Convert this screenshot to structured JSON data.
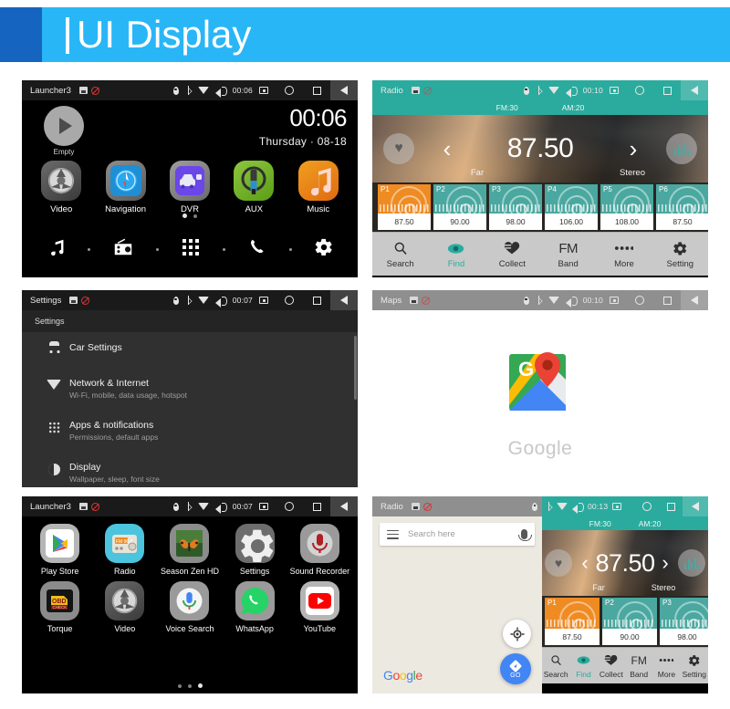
{
  "banner": {
    "title": "UI Display",
    "accent": "#29b6f6",
    "accent_dark": "#1565c0"
  },
  "panels": {
    "launcher": {
      "statusbar": {
        "title": "Launcher3",
        "clock": "00:06",
        "icons": [
          "sd-card-icon",
          "no-sim-icon",
          "location-icon",
          "bluetooth-icon",
          "wifi-icon",
          "volume-icon",
          "screenshot-icon",
          "home-icon",
          "recents-icon",
          "back-icon"
        ]
      },
      "clock": "00:06",
      "date": "Thursday · 08-18",
      "empty_slot_label": "Empty",
      "apps": [
        {
          "label": "Video",
          "icon": "video-reel-icon"
        },
        {
          "label": "Navigation",
          "icon": "compass-icon"
        },
        {
          "label": "DVR",
          "icon": "dashcam-icon"
        },
        {
          "label": "AUX",
          "icon": "aux-jack-icon"
        },
        {
          "label": "Music",
          "icon": "music-note-icon"
        }
      ],
      "page_dots": 2,
      "page_active": 0,
      "dock": [
        "music-note-icon",
        "radio-icon",
        "app-grid-icon",
        "phone-icon",
        "settings-gear-icon"
      ]
    },
    "radio": {
      "statusbar": {
        "title": "Radio",
        "clock": "00:10"
      },
      "band_info": {
        "fm": "FM:30",
        "am": "AM:20"
      },
      "frequency": "87.50",
      "mode_left": "Far",
      "mode_right": "Stereo",
      "prev_icon": "chevron-left-icon",
      "next_icon": "chevron-right-icon",
      "favorite_icon": "heart-icon",
      "equalizer_icon": "equalizer-icon",
      "presets": [
        {
          "slot": "P1",
          "freq": "87.50",
          "active": true
        },
        {
          "slot": "P2",
          "freq": "90.00",
          "active": false
        },
        {
          "slot": "P3",
          "freq": "98.00",
          "active": false
        },
        {
          "slot": "P4",
          "freq": "106.00",
          "active": false
        },
        {
          "slot": "P5",
          "freq": "108.00",
          "active": false
        },
        {
          "slot": "P6",
          "freq": "87.50",
          "active": false
        }
      ],
      "toolbar": [
        {
          "label": "Search",
          "icon": "magnifier-icon",
          "active": false
        },
        {
          "label": "Find",
          "icon": "eye-icon",
          "active": true
        },
        {
          "label": "Collect",
          "icon": "collect-icon",
          "active": false
        },
        {
          "label": "Band",
          "icon": "fm-text-icon",
          "active": false,
          "top_text": "FM"
        },
        {
          "label": "More",
          "icon": "more-dots-icon",
          "active": false
        },
        {
          "label": "Setting",
          "icon": "gear-icon",
          "active": false
        }
      ],
      "accent": "#2bab9e",
      "active_preset_color": "#ef8b23"
    },
    "settings": {
      "statusbar": {
        "title": "Settings",
        "clock": "00:07"
      },
      "header": "Settings",
      "items": [
        {
          "title": "Car Settings",
          "subtitle": "",
          "icon": "car-icon"
        },
        {
          "title": "Network & Internet",
          "subtitle": "Wi-Fi, mobile, data usage, hotspot",
          "icon": "wifi-icon"
        },
        {
          "title": "Apps & notifications",
          "subtitle": "Permissions, default apps",
          "icon": "apps-grid-icon"
        },
        {
          "title": "Display",
          "subtitle": "Wallpaper, sleep, font size",
          "icon": "brightness-icon"
        }
      ]
    },
    "maps": {
      "statusbar": {
        "title": "Maps",
        "clock": "00:10"
      },
      "brand": "Google",
      "logo_icon": "google-maps-logo-icon"
    },
    "drawer": {
      "statusbar": {
        "title": "Launcher3",
        "clock": "00:07"
      },
      "apps_row1": [
        {
          "label": "Play Store",
          "icon": "play-store-icon"
        },
        {
          "label": "Radio",
          "icon": "radio-icon"
        },
        {
          "label": "Season Zen HD",
          "icon": "butterfly-wallpaper-icon"
        },
        {
          "label": "Settings",
          "icon": "settings-gear-icon"
        },
        {
          "label": "Sound Recorder",
          "icon": "microphone-icon"
        }
      ],
      "apps_row2": [
        {
          "label": "Torque",
          "icon": "obd-check-icon"
        },
        {
          "label": "Video",
          "icon": "video-reel-icon"
        },
        {
          "label": "Voice Search",
          "icon": "voice-search-icon"
        },
        {
          "label": "WhatsApp",
          "icon": "whatsapp-icon"
        },
        {
          "label": "YouTube",
          "icon": "youtube-icon"
        }
      ],
      "page_dots": 3,
      "page_active": 2
    },
    "split": {
      "maps": {
        "statusbar": {
          "title": "Radio"
        },
        "search_placeholder": "Search here",
        "menu_icon": "hamburger-icon",
        "mic_icon": "microphone-icon",
        "locate_icon": "my-location-icon",
        "go_label": "GO",
        "brand": "Google"
      },
      "radio": {
        "statusbar": {
          "clock": "00:13"
        },
        "band_info": {
          "fm": "FM:30",
          "am": "AM:20"
        },
        "frequency": "87.50",
        "mode_left": "Far",
        "mode_right": "Stereo",
        "presets": [
          {
            "slot": "P1",
            "freq": "87.50",
            "active": true
          },
          {
            "slot": "P2",
            "freq": "90.00",
            "active": false
          },
          {
            "slot": "P3",
            "freq": "98.00",
            "active": false
          }
        ],
        "toolbar": [
          {
            "label": "Search",
            "active": false
          },
          {
            "label": "Find",
            "active": true
          },
          {
            "label": "Collect",
            "active": false
          },
          {
            "label": "Band",
            "active": false
          },
          {
            "label": "More",
            "active": false
          },
          {
            "label": "Setting",
            "active": false
          }
        ]
      }
    }
  }
}
